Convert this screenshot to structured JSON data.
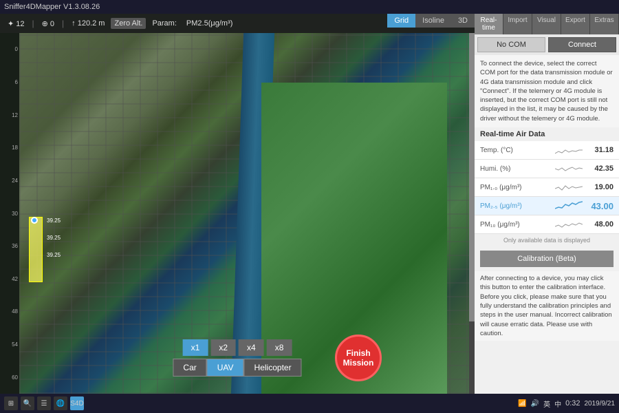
{
  "titlebar": {
    "title": "Sniffer4DMapper V1.3.08.26"
  },
  "toolbar": {
    "zoom": "✦ 12",
    "crosshair": "⊕ 0",
    "altitude": "↑ 120.2 m",
    "zero_alt": "Zero Alt.",
    "param": "Param:",
    "pm25": "PM2.5(μg/m³)"
  },
  "map_tabs": [
    {
      "label": "Grid",
      "active": true
    },
    {
      "label": "Isoline",
      "active": false
    },
    {
      "label": "3D",
      "active": false
    }
  ],
  "scale": {
    "marks": [
      "0",
      "6",
      "12",
      "18",
      "24",
      "30",
      "36",
      "42",
      "48",
      "54",
      "60"
    ]
  },
  "speed_buttons": [
    {
      "label": "x1",
      "active": true
    },
    {
      "label": "x2",
      "active": false
    },
    {
      "label": "x4",
      "active": false
    },
    {
      "label": "x8",
      "active": false
    }
  ],
  "vehicle_buttons": [
    {
      "label": "Car",
      "active": false
    },
    {
      "label": "UAV",
      "active": true
    },
    {
      "label": "Helicopter",
      "active": false
    }
  ],
  "finish_mission": {
    "label": "Finish\nMission"
  },
  "right_panel": {
    "tabs": [
      {
        "label": "Real-time",
        "active": true
      },
      {
        "label": "Import",
        "active": false
      },
      {
        "label": "Visual",
        "active": false
      },
      {
        "label": "Export",
        "active": false
      },
      {
        "label": "Extras",
        "active": false
      }
    ],
    "no_com_label": "No COM",
    "connect_label": "Connect",
    "connect_desc": "To connect the device, select the correct COM port for the data transmission module or 4G data transmission module and click \"Connect\". If the telemery or 4G module is inserted, but the correct COM port is still not displayed in the list, it may be caused by the driver without the telemery or 4G module.",
    "realtime_title": "Real-time Air Data",
    "data_rows": [
      {
        "label": "Temp. (°C)",
        "value": "31.18",
        "highlight": false
      },
      {
        "label": "Humi. (%)",
        "value": "42.35",
        "highlight": false
      },
      {
        "label": "PM₁.₀ (μg/m³)",
        "value": "19.00",
        "highlight": false
      },
      {
        "label": "PM₂.₅ (μg/m³)",
        "value": "43.00",
        "highlight": true
      },
      {
        "label": "PM₁₀ (μg/m³)",
        "value": "48.00",
        "highlight": false
      }
    ],
    "only_notice": "Only available data is displayed",
    "calibration_label": "Calibration (Beta)",
    "calibration_desc": "After connecting to a device, you may click this button to enter the calibration interface. Before you click, please make sure that you fully understand the calibration principles and steps in the user manual. Incorrect calibration will cause erratic data. Please use with caution."
  },
  "taskbar": {
    "time": "0:32",
    "date": "2019/9/21",
    "icons": [
      "⊞",
      "⇧",
      "☰",
      "🌐",
      "4D",
      "●",
      "▶",
      "⚙",
      "英",
      "中",
      "∧",
      "♪",
      "🔋",
      "📶"
    ]
  },
  "ruler_marks": [
    "0",
    "6",
    "12",
    "18",
    "24",
    "30",
    "36",
    "42",
    "48",
    "54",
    "60"
  ]
}
